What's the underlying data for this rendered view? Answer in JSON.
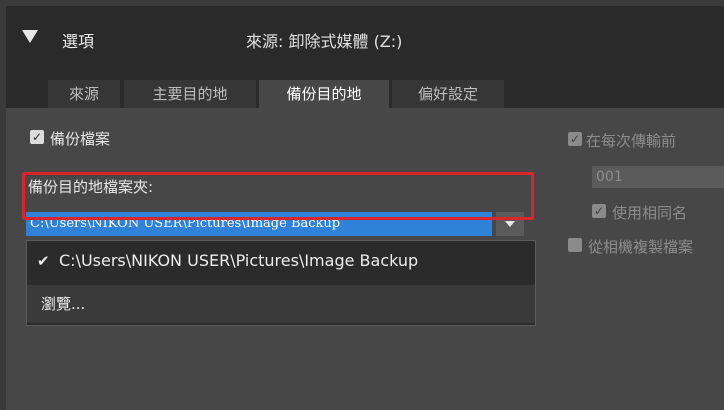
{
  "header": {
    "title": "選項",
    "source": "來源: 卸除式媒體 (Z:)"
  },
  "tabs": [
    {
      "label": "來源",
      "active": false
    },
    {
      "label": "主要目的地",
      "active": false
    },
    {
      "label": "備份目的地",
      "active": true
    },
    {
      "label": "偏好設定",
      "active": false
    }
  ],
  "backup": {
    "backup_files_label": "備份檔案",
    "backup_files_checked": true,
    "dest_folder_label": "備份目的地檔案夾:",
    "selected_path": "C:\\Users\\NIKON USER\\Pictures\\Image Backup"
  },
  "dropdown": {
    "options": [
      {
        "label": "C:\\Users\\NIKON USER\\Pictures\\Image Backup",
        "checked": true
      },
      {
        "label": "瀏覽..."
      }
    ]
  },
  "right_panel": {
    "rename_label": "在每次傳輸前",
    "number_value": "001",
    "same_name_label": "使用相同名",
    "copy_label": "從相機複製檔案"
  },
  "colors": {
    "selection_blue": "#2f82d8",
    "highlight_red": "#d8262c"
  }
}
